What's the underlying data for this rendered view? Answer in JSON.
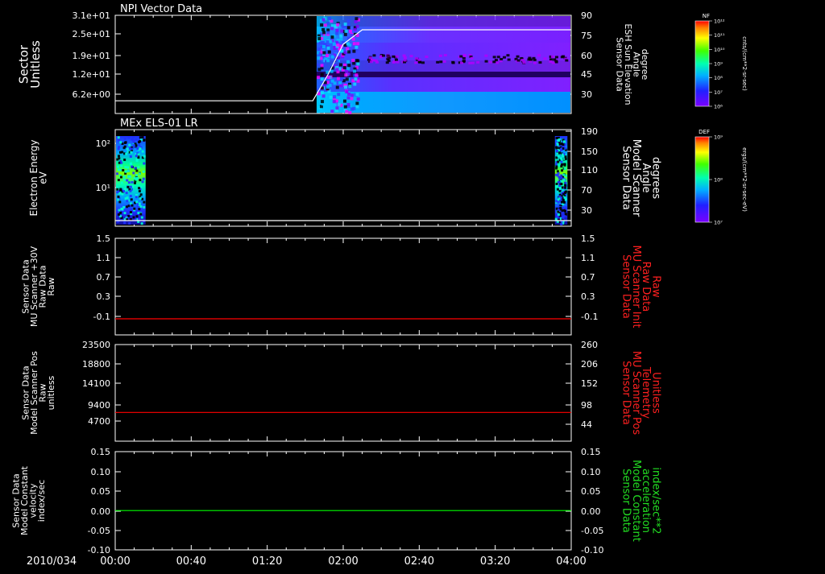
{
  "date_label": "2010/034",
  "time_ticks": [
    "00:00",
    "00:40",
    "01:20",
    "02:00",
    "02:40",
    "03:20",
    "04:00"
  ],
  "panels": [
    {
      "id": "npi",
      "title": "NPI Vector Data",
      "left_label": [
        "Sector",
        "Unitless"
      ],
      "left_ticks": [
        "3.1e+01",
        "2.5e+01",
        "1.9e+01",
        "1.2e+01",
        "6.2e+00"
      ],
      "right_label": [
        "Sensor Data",
        "ESH Sun Elevation",
        "Angle",
        "degree"
      ],
      "right_ticks": [
        "90",
        "75",
        "60",
        "45",
        "30"
      ],
      "right_color": "#ffffff"
    },
    {
      "id": "els",
      "title": "MEx ELS-01 LR",
      "left_label": [
        "Electron Energy",
        "eV"
      ],
      "left_ticks": [
        "10²",
        "10¹"
      ],
      "right_label": [
        "Sensor Data",
        "Model Scanner",
        "Angle",
        "degrees"
      ],
      "right_ticks": [
        "190",
        "150",
        "110",
        "70",
        "30"
      ],
      "right_color": "#ffffff"
    },
    {
      "id": "mu_raw",
      "title": "",
      "left_label": [
        "Sensor Data",
        "MU Scanner +30V",
        "Raw Data",
        "Raw"
      ],
      "left_ticks": [
        "1.5",
        "1.1",
        "0.7",
        "0.3",
        "-0.1"
      ],
      "right_label": [
        "Sensor Data",
        "MU Scanner Init",
        "Raw Data",
        "Raw"
      ],
      "right_ticks": [
        "1.5",
        "1.1",
        "0.7",
        "0.3",
        "-0.1"
      ],
      "right_color": "#ff2020"
    },
    {
      "id": "mu_pos",
      "title": "",
      "left_label": [
        "Sensor Data",
        "Model Scanner Pos",
        "Raw",
        "unitless"
      ],
      "left_ticks": [
        "23500",
        "18800",
        "14100",
        "9400",
        "4700"
      ],
      "right_label": [
        "Sensor Data",
        "MU Scanner Pos",
        "Telemetry",
        "Unitless"
      ],
      "right_ticks": [
        "260",
        "206",
        "152",
        "98",
        "44"
      ],
      "right_color": "#ff2020"
    },
    {
      "id": "model_const",
      "title": "",
      "left_label": [
        "Sensor Data",
        "Model Constant",
        "velocity",
        "index/sec"
      ],
      "left_ticks": [
        "0.15",
        "0.10",
        "0.05",
        "0.00",
        "-0.05",
        "-0.10"
      ],
      "right_label": [
        "Sensor Data",
        "Model Constant",
        "acceleration",
        "index/sec**2"
      ],
      "right_ticks": [
        "0.15",
        "0.10",
        "0.05",
        "0.00",
        "-0.05",
        "-0.10"
      ],
      "right_color": "#22dd22"
    }
  ],
  "colorbars": [
    {
      "id": "nf",
      "label": "NF",
      "ticks": [
        "10¹²",
        "10¹¹",
        "10¹⁰",
        "10⁹",
        "10⁸",
        "10⁷",
        "10⁶"
      ],
      "units": "cnts/(cm**2-sr-sec)"
    },
    {
      "id": "def",
      "label": "DEF",
      "ticks": [
        "10⁹",
        "10⁸",
        "10⁷"
      ],
      "units": "ergs/(cm**2-sr-sec-eV)"
    }
  ],
  "chart_data": [
    {
      "type": "heatmap",
      "title": "NPI Vector Data",
      "y_label": "Sector Unitless",
      "x_range": [
        "00:00",
        "04:00"
      ],
      "data_start": "01:46",
      "overlay_line": {
        "name": "ESH Sun Elevation Angle",
        "units": "degree",
        "points": [
          [
            "00:00",
            25
          ],
          [
            "01:44",
            25
          ],
          [
            "01:52",
            45
          ],
          [
            "02:00",
            68
          ],
          [
            "02:10",
            79
          ],
          [
            "04:00",
            79
          ]
        ]
      }
    },
    {
      "type": "heatmap",
      "title": "MEx ELS-01 LR",
      "y_label": "Electron Energy eV",
      "y_scale": "log",
      "data_intervals": [
        [
          "00:00",
          "00:16"
        ],
        [
          "03:51",
          "03:58"
        ]
      ],
      "overlay_line": {
        "name": "Model Scanner Angle",
        "units": "degrees",
        "points": [
          [
            "00:00",
            15
          ],
          [
            "04:00",
            15
          ]
        ]
      }
    },
    {
      "type": "line",
      "y_label": "MU Scanner +30V Raw Data",
      "ylim": [
        -0.3,
        1.5
      ],
      "series": [
        {
          "name": "MU Scanner Init Raw Data",
          "color": "#ff0000",
          "values": [
            [
              0,
              0.0
            ],
            [
              240,
              0.0
            ]
          ]
        }
      ]
    },
    {
      "type": "line",
      "y_label": "Model Scanner Pos Raw",
      "ylim": [
        0,
        23500
      ],
      "series": [
        {
          "name": "MU Scanner Pos Telemetry",
          "color": "#ff0000",
          "values": [
            [
              0,
              7000
            ],
            [
              240,
              7000
            ]
          ]
        }
      ]
    },
    {
      "type": "line",
      "y_label": "Model Constant velocity",
      "ylim": [
        -0.1,
        0.15
      ],
      "series": [
        {
          "name": "Model Constant acceleration",
          "color": "#00ff00",
          "values": [
            [
              0,
              0.0
            ],
            [
              240,
              0.0
            ]
          ]
        }
      ]
    }
  ]
}
